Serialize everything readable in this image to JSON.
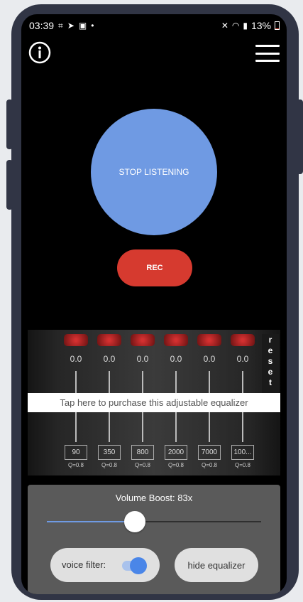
{
  "status_bar": {
    "time": "03:39",
    "icons_left": [
      "screenshot-icon",
      "send-icon",
      "image-icon",
      "dot-icon"
    ],
    "icons_right": [
      "mute-icon",
      "wifi-icon",
      "signal-icon"
    ],
    "battery": "13%",
    "battery_level": 0.13,
    "battery_color": "#e74c3c"
  },
  "header": {
    "info_icon": "info-icon",
    "menu_icon": "hamburger-menu-icon"
  },
  "listen_button": {
    "label": "STOP LISTENING",
    "color": "#6f9ae3"
  },
  "rec_button": {
    "label": "REC",
    "color": "#d63a2f"
  },
  "equalizer": {
    "bands": [
      {
        "value": "0.0",
        "freq": "90",
        "q": "Q=0.8"
      },
      {
        "value": "0.0",
        "freq": "350",
        "q": "Q=0.8"
      },
      {
        "value": "0.0",
        "freq": "800",
        "q": "Q=0.8"
      },
      {
        "value": "0.0",
        "freq": "2000",
        "q": "Q=0.8"
      },
      {
        "value": "0.0",
        "freq": "7000",
        "q": "Q=0.8"
      },
      {
        "value": "0.0",
        "freq": "100...",
        "q": "Q=0.8"
      }
    ],
    "reset": [
      "r",
      "e",
      "s",
      "e",
      "t"
    ],
    "purchase_banner": "Tap here to purchase this adjustable equalizer"
  },
  "controls": {
    "volume_boost_label": "Volume Boost: 83x",
    "volume_slider_fraction": 0.41,
    "voice_filter_label": "voice filter:",
    "voice_filter_on": true,
    "hide_equalizer_label": "hide equalizer",
    "accent_color": "#6f9ae3"
  }
}
